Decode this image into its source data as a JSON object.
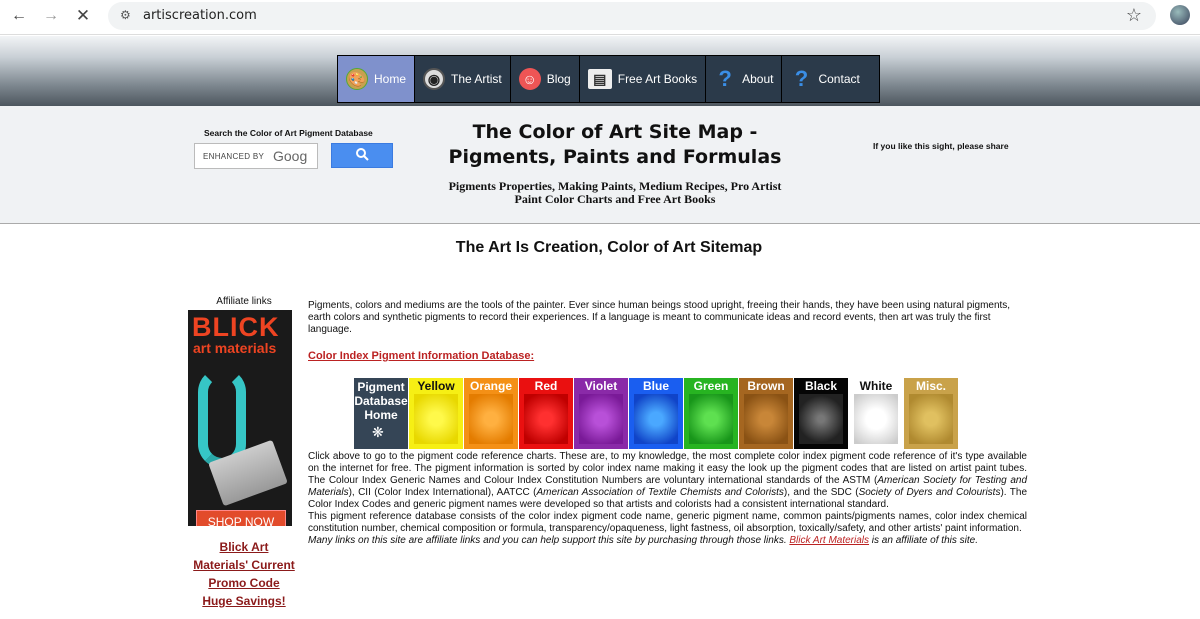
{
  "browser": {
    "url": "artiscreation.com"
  },
  "nav": {
    "items": [
      {
        "label": "Home",
        "icon": "palette-icon",
        "active": true
      },
      {
        "label": "The Artist",
        "icon": "eye-icon"
      },
      {
        "label": "Blog",
        "icon": "face-icon"
      },
      {
        "label": "Free Art Books",
        "icon": "book-icon"
      },
      {
        "label": "About",
        "icon": "help-icon"
      },
      {
        "label": "Contact",
        "icon": "help-icon"
      }
    ]
  },
  "header": {
    "search_label": "Search the Color of Art Pigment Database",
    "search_placeholder_enhanced": "ENHANCED BY",
    "search_placeholder_brand": "Goog",
    "title_line1": "The Color of Art Site Map -",
    "title_line2": "Pigments, Paints and Formulas",
    "subtitle_line1": "Pigments Properties, Making Paints, Medium Recipes, Pro Artist",
    "subtitle_line2": "Paint Color Charts and Free Art Books",
    "share_text": "If you like this sight, please share"
  },
  "main": {
    "heading": "The Art Is Creation, Color of Art Sitemap",
    "intro": "Pigments, colors and mediums are the tools of the painter. Ever since human beings stood upright, freeing their hands, they have been using natural pigments, earth colors and synthetic pigments to record their experiences. If a language is meant to communicate ideas and record events, then art was truly the first language.",
    "ci_link": "Color Index Pigment Information Database:",
    "swatches": [
      {
        "label_lines": [
          "Pigment",
          "Database",
          "Home"
        ],
        "color": "#354556"
      },
      {
        "label": "Yellow",
        "color": "#f6ef14"
      },
      {
        "label": "Orange",
        "color": "#f49016"
      },
      {
        "label": "Red",
        "color": "#ea1010"
      },
      {
        "label": "Violet",
        "color": "#8a2aa8"
      },
      {
        "label": "Blue",
        "color": "#1a5ef0"
      },
      {
        "label": "Green",
        "color": "#27b421"
      },
      {
        "label": "Brown",
        "color": "#a56620"
      },
      {
        "label": "Black",
        "color": "#050505"
      },
      {
        "label": "White",
        "color": "#ffffff"
      },
      {
        "label": "Misc.",
        "color": "#c9a24a"
      }
    ],
    "para1_a": "Click above to go to the pigment code reference charts. These are, to my knowledge, the most complete color index pigment code reference of it's type available on the internet for free. The pigment information is sorted by color index name making it easy the look up the pigment codes that are listed on artist paint tubes. The Colour Index Generic Names and Colour Index Constitution Numbers are voluntary international standards of the ASTM (",
    "para1_astm": "American Society for Testing and Materials",
    "para1_b": "), CII (Color Index International), AATCC (",
    "para1_aatcc": "American Association of Textile Chemists and Colorists",
    "para1_c": "), and the SDC (",
    "para1_sdc": "Society of Dyers and Colourists",
    "para1_d": "). The Color Index Codes and generic pigment names were developed so that artists and colorists had a consistent international standard.",
    "para2": "This pigment reference database consists of the color index pigment code name, generic pigment name, common paints/pigments names, color index chemical constitution number, chemical composition or formula, transparency/opaqueness, light fastness, oil absorption, toxically/safety, and other artists' paint information.",
    "para3_a": "Many links on this site are affiliate links and you can help support this site by purchasing through those links. ",
    "para3_link": "Blick Art Materials",
    "para3_b": " is an affiliate of this site."
  },
  "sidebar": {
    "affiliate_label": "Affiliate links",
    "ad_logo": "BLICK",
    "ad_logo_sub": "art materials",
    "ad_button": "SHOP NOW",
    "promo_lines": [
      "Blick Art",
      "Materials' Current",
      "Promo Code",
      "Huge Savings!"
    ]
  }
}
